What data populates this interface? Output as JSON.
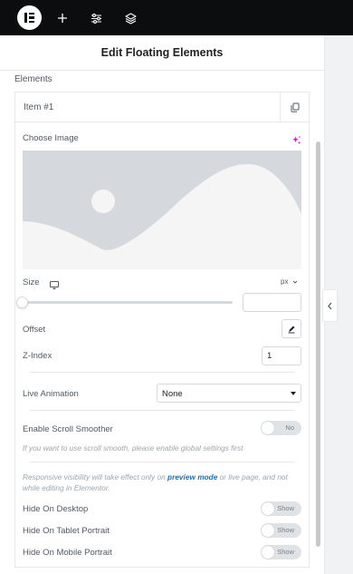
{
  "topbar": {
    "logo_icon": "elementor-logo-icon",
    "icons": [
      "plus-icon",
      "sliders-icon",
      "layers-icon"
    ]
  },
  "header": {
    "title": "Edit Floating Elements"
  },
  "section": {
    "label": "Elements"
  },
  "repeater": {
    "item_title": "Item #1",
    "duplicate_icon": "copy-icon"
  },
  "controls": {
    "choose_image": "Choose Image",
    "ai_icon": "sparkle-icon",
    "size_label": "Size",
    "size_unit": "px",
    "size_value": "",
    "slider_position": 0,
    "offset_label": "Offset",
    "zindex_label": "Z-Index",
    "zindex_value": "1",
    "live_animation_label": "Live Animation",
    "live_animation_value": "None",
    "scroll_smoother_label": "Enable Scroll Smoother",
    "scroll_smoother_toggle": "No",
    "scroll_hint": "If you want to use scroll smooth, please enable global settings first",
    "visibility_hint_pre": "Responsive visibility will take effect only on ",
    "visibility_hint_link": "preview mode",
    "visibility_hint_post": " or live page, and not while editing in Elementor.",
    "hide_desktop_label": "Hide On Desktop",
    "hide_tablet_label": "Hide On Tablet Portrait",
    "hide_mobile_label": "Hide On Mobile Portrait",
    "show_toggle": "Show"
  },
  "colors": {
    "toolbar_bg": "#0c0d0e",
    "link": "#2271b1",
    "ai_accent": "#c026d3",
    "placeholder_bg": "#d5d8dc"
  }
}
